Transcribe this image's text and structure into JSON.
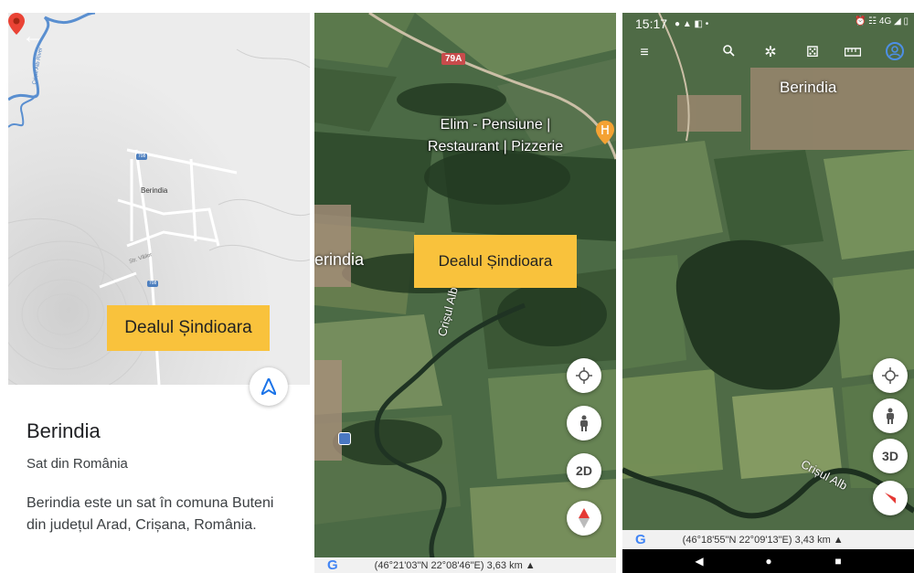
{
  "panel_map": {
    "village_label": "Berindia",
    "river_label": "Crișul Alb River",
    "street_label": "Str. Văilor",
    "road_badge_top": "708",
    "road_badge_bottom": "708",
    "highlight": "Dealul Șindioara",
    "place_title": "Berindia",
    "place_subtitle": "Sat din România",
    "place_description": "Berindia este un sat în comuna Buteni din județul Arad, Crișana, România.",
    "icons": {
      "back": "arrow-back-icon",
      "pin": "map-pin-icon",
      "navigate": "navigation-arrow-icon"
    }
  },
  "panel_satellite": {
    "route_badge": "79A",
    "poi_name": "Elim - Pensiune | Restaurant | Pizzerie",
    "village_label": "erindia",
    "highlight": "Dealul Șindioara",
    "river_label": "Crișul Alb",
    "controls": {
      "mode_label": "2D"
    },
    "footer_logo": "G",
    "footer_coords": "(46°21'03\"N 22°08'46\"E) 3,63 km ▲",
    "icons": {
      "locate": "my-location-icon",
      "pegman": "street-view-person-icon",
      "compass": "compass-icon",
      "poi": "restaurant-pin-icon",
      "bus": "bus-stop-icon"
    }
  },
  "panel_earth": {
    "status_time": "15:17",
    "status_left_icons": "● ▲ ◧ •",
    "status_right_icons": "⏰ ☷ 4G ◢ ▯",
    "village_label": "Berindia",
    "river_label": "Crișul Alb",
    "controls": {
      "mode_label": "3D"
    },
    "footer_logo": "G",
    "footer_coords": "(46°18'55\"N 22°09'13\"E) 3,43 km ▲",
    "icons": {
      "menu": "hamburger-menu-icon",
      "search": "search-icon",
      "voyager": "ship-wheel-icon",
      "feeling_lucky": "dice-icon",
      "measure": "ruler-icon",
      "account": "account-circle-icon",
      "locate": "my-location-icon",
      "pegman": "street-view-person-icon",
      "compass": "compass-icon",
      "nav_back": "nav-back-icon",
      "nav_home": "nav-home-icon",
      "nav_recents": "nav-recents-icon"
    }
  }
}
